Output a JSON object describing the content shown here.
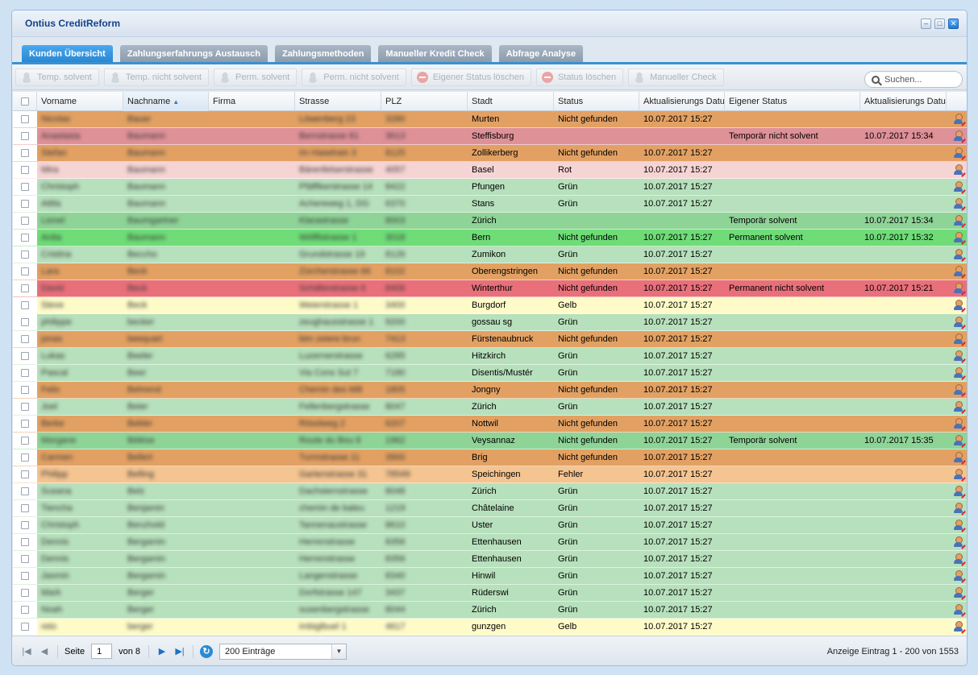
{
  "window": {
    "title": "Ontius CreditReform"
  },
  "tabs": [
    {
      "label": "Kunden Übersicht",
      "active": true
    },
    {
      "label": "Zahlungserfahrungs Austausch",
      "active": false
    },
    {
      "label": "Zahlungsmethoden",
      "active": false
    },
    {
      "label": "Manueller Kredit Check",
      "active": false
    },
    {
      "label": "Abfrage Analyse",
      "active": false
    }
  ],
  "toolbar": {
    "buttons": [
      {
        "label": "Temp. solvent",
        "icon": "person-icon"
      },
      {
        "label": "Temp. nicht solvent",
        "icon": "person-icon"
      },
      {
        "label": "Perm. solvent",
        "icon": "person-icon"
      },
      {
        "label": "Perm. nicht solvent",
        "icon": "person-icon"
      },
      {
        "label": "Eigener Status löschen",
        "icon": "minus-circle-icon"
      },
      {
        "label": "Status löschen",
        "icon": "minus-circle-icon"
      },
      {
        "label": "Manueller Check",
        "icon": "person-icon"
      }
    ],
    "search_placeholder": "Suchen..."
  },
  "grid": {
    "columns": [
      "Vorname",
      "Nachname",
      "Firma",
      "Strasse",
      "PLZ",
      "Stadt",
      "Status",
      "Aktualisierungs Datum",
      "Eigener Status",
      "Aktualisierungs Datum"
    ],
    "sorted_column": "Nachname",
    "row_colors": {
      "orange": "#e2a163",
      "pinkred": "#df9198",
      "pink": "#f7d4d4",
      "green": "#b7e0bc",
      "midgreen": "#8fd497",
      "brightgreen": "#6fdc78",
      "red": "#e9707b",
      "yellow": "#fefbc9",
      "peach": "#f4c491"
    },
    "rows": [
      {
        "color": "orange",
        "vorname": "Nicolas",
        "nachname": "Bauer",
        "strasse": "Löwenberg 23",
        "plz": "3280",
        "stadt": "Murten",
        "status": "Nicht gefunden",
        "datum": "10.07.2017 15:27",
        "eigener_status": "",
        "eigener_datum": ""
      },
      {
        "color": "pinkred",
        "vorname": "Anastasia",
        "nachname": "Baumann",
        "strasse": "Bernstrasse 81",
        "plz": "3613",
        "stadt": "Steffisburg",
        "status": "",
        "datum": "",
        "eigener_status": "Temporär nicht solvent",
        "eigener_datum": "10.07.2017 15:34"
      },
      {
        "color": "orange",
        "vorname": "Stefan",
        "nachname": "Baumann",
        "strasse": "Im Haselrain 3",
        "plz": "8125",
        "stadt": "Zollikerberg",
        "status": "Nicht gefunden",
        "datum": "10.07.2017 15:27",
        "eigener_status": "",
        "eigener_datum": ""
      },
      {
        "color": "pink",
        "vorname": "Mira",
        "nachname": "Baumann",
        "strasse": "Bärenfelserstrasse",
        "plz": "4057",
        "stadt": "Basel",
        "status": "Rot",
        "datum": "10.07.2017 15:27",
        "eigener_status": "",
        "eigener_datum": ""
      },
      {
        "color": "green",
        "vorname": "Christoph",
        "nachname": "Baumann",
        "strasse": "Pfäffikerstrasse 14",
        "plz": "8422",
        "stadt": "Pfungen",
        "status": "Grün",
        "datum": "10.07.2017 15:27",
        "eigener_status": "",
        "eigener_datum": ""
      },
      {
        "color": "green",
        "vorname": "Attila",
        "nachname": "Baumann",
        "strasse": "Achereweg 1, DG",
        "plz": "6370",
        "stadt": "Stans",
        "status": "Grün",
        "datum": "10.07.2017 15:27",
        "eigener_status": "",
        "eigener_datum": ""
      },
      {
        "color": "midgreen",
        "vorname": "Lionel",
        "nachname": "Baumgartner",
        "strasse": "Klarastrasse",
        "plz": "8003",
        "stadt": "Zürich",
        "status": "",
        "datum": "",
        "eigener_status": "Temporär solvent",
        "eigener_datum": "10.07.2017 15:34"
      },
      {
        "color": "brightgreen",
        "vorname": "Anita",
        "nachname": "Baumann",
        "strasse": "Wölflistrasse 1",
        "plz": "3018",
        "stadt": "Bern",
        "status": "Nicht gefunden",
        "datum": "10.07.2017 15:27",
        "eigener_status": "Permanent solvent",
        "eigener_datum": "10.07.2017 15:32"
      },
      {
        "color": "green",
        "vorname": "Cristina",
        "nachname": "Beccho",
        "strasse": "Grundstrasse 19",
        "plz": "8126",
        "stadt": "Zumikon",
        "status": "Grün",
        "datum": "10.07.2017 15:27",
        "eigener_status": "",
        "eigener_datum": ""
      },
      {
        "color": "orange",
        "vorname": "Lara",
        "nachname": "Beck",
        "strasse": "Zürcherstrasse 66",
        "plz": "8102",
        "stadt": "Oberengstringen",
        "status": "Nicht gefunden",
        "datum": "10.07.2017 15:27",
        "eigener_status": "",
        "eigener_datum": ""
      },
      {
        "color": "red",
        "vorname": "David",
        "nachname": "Beck",
        "strasse": "Schäferstrasse 6",
        "plz": "8406",
        "stadt": "Winterthur",
        "status": "Nicht gefunden",
        "datum": "10.07.2017 15:27",
        "eigener_status": "Permanent nicht solvent",
        "eigener_datum": "10.07.2017 15:21"
      },
      {
        "color": "yellow",
        "vorname": "Steve",
        "nachname": "Beck",
        "strasse": "Weierstrasse 1",
        "plz": "3400",
        "stadt": "Burgdorf",
        "status": "Gelb",
        "datum": "10.07.2017 15:27",
        "eigener_status": "",
        "eigener_datum": ""
      },
      {
        "color": "green",
        "vorname": "philippe",
        "nachname": "becker",
        "strasse": "zeughausstrasse 1",
        "plz": "9200",
        "stadt": "gossau sg",
        "status": "Grün",
        "datum": "10.07.2017 15:27",
        "eigener_status": "",
        "eigener_datum": ""
      },
      {
        "color": "orange",
        "vorname": "jonas",
        "nachname": "beequart",
        "strasse": "bim zeiere brun",
        "plz": "7413",
        "stadt": "Fürstenaubruck",
        "status": "Nicht gefunden",
        "datum": "10.07.2017 15:27",
        "eigener_status": "",
        "eigener_datum": ""
      },
      {
        "color": "green",
        "vorname": "Lukas",
        "nachname": "Beeler",
        "strasse": "Luzernerstrasse",
        "plz": "6285",
        "stadt": "Hitzkirch",
        "status": "Grün",
        "datum": "10.07.2017 15:27",
        "eigener_status": "",
        "eigener_datum": ""
      },
      {
        "color": "green",
        "vorname": "Pascal",
        "nachname": "Beer",
        "strasse": "Via Cons Sut 7",
        "plz": "7180",
        "stadt": "Disentis/Mustér",
        "status": "Grün",
        "datum": "10.07.2017 15:27",
        "eigener_status": "",
        "eigener_datum": ""
      },
      {
        "color": "orange",
        "vorname": "Felix",
        "nachname": "Behrend",
        "strasse": "Chemin des Mill",
        "plz": "1805",
        "stadt": "Jongny",
        "status": "Nicht gefunden",
        "datum": "10.07.2017 15:27",
        "eigener_status": "",
        "eigener_datum": ""
      },
      {
        "color": "green",
        "vorname": "Joel",
        "nachname": "Beier",
        "strasse": "Fellenbergstrasse",
        "plz": "8047",
        "stadt": "Zürich",
        "status": "Grün",
        "datum": "10.07.2017 15:27",
        "eigener_status": "",
        "eigener_datum": ""
      },
      {
        "color": "orange",
        "vorname": "Berke",
        "nachname": "Bekler",
        "strasse": "Rösslweg 2",
        "plz": "6207",
        "stadt": "Nottwil",
        "status": "Nicht gefunden",
        "datum": "10.07.2017 15:27",
        "eigener_status": "",
        "eigener_datum": ""
      },
      {
        "color": "midgreen",
        "vorname": "Morgane",
        "nachname": "Bélése",
        "strasse": "Route du Bou 8",
        "plz": "1962",
        "stadt": "Veysannaz",
        "status": "Nicht gefunden",
        "datum": "10.07.2017 15:27",
        "eigener_status": "Temporär solvent",
        "eigener_datum": "10.07.2017 15:35"
      },
      {
        "color": "orange",
        "vorname": "Carmen",
        "nachname": "Bellert",
        "strasse": "Turmstrasse 11",
        "plz": "3900",
        "stadt": "Brig",
        "status": "Nicht gefunden",
        "datum": "10.07.2017 15:27",
        "eigener_status": "",
        "eigener_datum": ""
      },
      {
        "color": "peach",
        "vorname": "Philipp",
        "nachname": "Belling",
        "strasse": "Gartenstrasse 31",
        "plz": "78549",
        "stadt": "Speichingen",
        "status": "Fehler",
        "datum": "10.07.2017 15:27",
        "eigener_status": "",
        "eigener_datum": ""
      },
      {
        "color": "green",
        "vorname": "Susana",
        "nachname": "Belz",
        "strasse": "Dachslernstrasse",
        "plz": "8048",
        "stadt": "Zürich",
        "status": "Grün",
        "datum": "10.07.2017 15:27",
        "eigener_status": "",
        "eigener_datum": ""
      },
      {
        "color": "green",
        "vorname": "Tiencha",
        "nachname": "Benjamin",
        "strasse": "chemin de baleu",
        "plz": "1219",
        "stadt": "Châtelaine",
        "status": "Grün",
        "datum": "10.07.2017 15:27",
        "eigener_status": "",
        "eigener_datum": ""
      },
      {
        "color": "green",
        "vorname": "Christoph",
        "nachname": "Benzhold",
        "strasse": "Tannenaustrasse",
        "plz": "8610",
        "stadt": "Uster",
        "status": "Grün",
        "datum": "10.07.2017 15:27",
        "eigener_status": "",
        "eigener_datum": ""
      },
      {
        "color": "green",
        "vorname": "Dennis",
        "nachname": "Bergamin",
        "strasse": "Herrenstrasse",
        "plz": "8356",
        "stadt": "Ettenhausen",
        "status": "Grün",
        "datum": "10.07.2017 15:27",
        "eigener_status": "",
        "eigener_datum": ""
      },
      {
        "color": "green",
        "vorname": "Dennis",
        "nachname": "Bergamin",
        "strasse": "Herrenstrasse",
        "plz": "8356",
        "stadt": "Ettenhausen",
        "status": "Grün",
        "datum": "10.07.2017 15:27",
        "eigener_status": "",
        "eigener_datum": ""
      },
      {
        "color": "green",
        "vorname": "Jasmin",
        "nachname": "Bergamin",
        "strasse": "Langenstrasse",
        "plz": "8340",
        "stadt": "Hinwil",
        "status": "Grün",
        "datum": "10.07.2017 15:27",
        "eigener_status": "",
        "eigener_datum": ""
      },
      {
        "color": "green",
        "vorname": "Mark",
        "nachname": "Berger",
        "strasse": "Dorfstrasse 147",
        "plz": "3437",
        "stadt": "Rüderswi",
        "status": "Grün",
        "datum": "10.07.2017 15:27",
        "eigener_status": "",
        "eigener_datum": ""
      },
      {
        "color": "green",
        "vorname": "Noah",
        "nachname": "Berger",
        "strasse": "susenbergstrasse",
        "plz": "8044",
        "stadt": "Zürich",
        "status": "Grün",
        "datum": "10.07.2017 15:27",
        "eigener_status": "",
        "eigener_datum": ""
      },
      {
        "color": "yellow",
        "vorname": "reto",
        "nachname": "berger",
        "strasse": "imbiglbuel 1",
        "plz": "4617",
        "stadt": "gunzgen",
        "status": "Gelb",
        "datum": "10.07.2017 15:27",
        "eigener_status": "",
        "eigener_datum": ""
      }
    ]
  },
  "footer": {
    "page_label": "Seite",
    "page_value": "1",
    "of_label": "von 8",
    "per_page": "200 Einträge",
    "info": "Anzeige Eintrag 1 - 200 von 1553"
  }
}
